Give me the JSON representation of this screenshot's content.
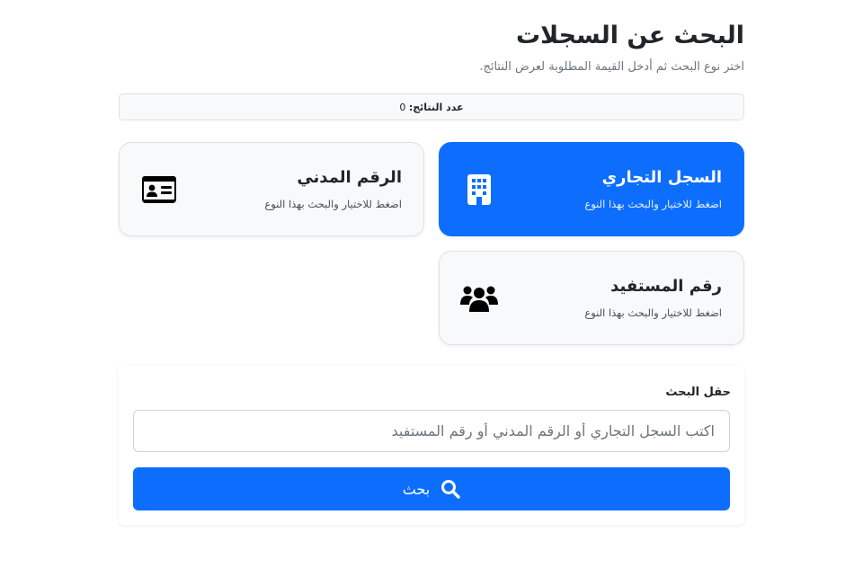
{
  "header": {
    "title": "البحث عن السجلات",
    "subtitle": "اختر نوع البحث ثم أدخل القيمة المطلوبة لعرض النتائج."
  },
  "results": {
    "label": "عدد النتائج:",
    "count": "0"
  },
  "search_types": [
    {
      "title": "السجل التجاري",
      "hint": "اضغط للاختيار والبحث بهذا النوع",
      "icon": "building-icon",
      "selected": true
    },
    {
      "title": "الرقم المدني",
      "hint": "اضغط للاختيار والبحث بهذا النوع",
      "icon": "id-card-icon",
      "selected": false
    },
    {
      "title": "رقم المستفيد",
      "hint": "اضغط للاختيار والبحث بهذا النوع",
      "icon": "users-icon",
      "selected": false
    }
  ],
  "search_form": {
    "label": "حقل البحث",
    "placeholder": "اكتب السجل التجاري أو الرقم المدني أو رقم المستفيد",
    "value": "",
    "button_label": "بحث",
    "button_icon": "search-icon"
  },
  "colors": {
    "accent": "#0d6efd",
    "card_bg": "#f8f9fa",
    "border": "#dee2e6"
  }
}
